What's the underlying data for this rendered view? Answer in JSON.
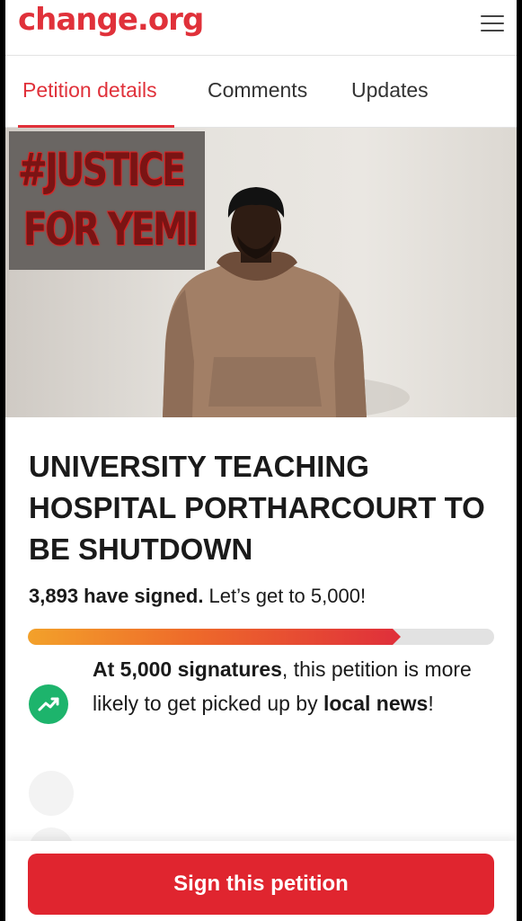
{
  "header": {
    "logo": "change.org",
    "menu_icon": "hamburger-menu-icon"
  },
  "tabs": [
    {
      "label": "Petition details",
      "active": true
    },
    {
      "label": "Comments",
      "active": false
    },
    {
      "label": "Updates",
      "active": false
    }
  ],
  "hero": {
    "banner_line1": "#JUSTICE",
    "banner_line2": "FOR YEMI"
  },
  "petition": {
    "title": "UNIVERSITY TEACHING HOSPITAL PORTHARCOURT TO BE SHUTDOWN",
    "signed_count": "3,893 have signed.",
    "signed_goal": " Let’s get to 5,000!",
    "progress_fraction": 0.8,
    "milestone_bold1": "At 5,000 signatures",
    "milestone_text": ", this petition is more likely to get picked up by ",
    "milestone_bold2": "local news",
    "milestone_end": "!",
    "milestone_icon": "trending-up-icon"
  },
  "actions": {
    "sign_label": "Sign this petition"
  },
  "colors": {
    "brand": "#e0313a",
    "trend": "#1db46c",
    "button": "#e0252f"
  }
}
